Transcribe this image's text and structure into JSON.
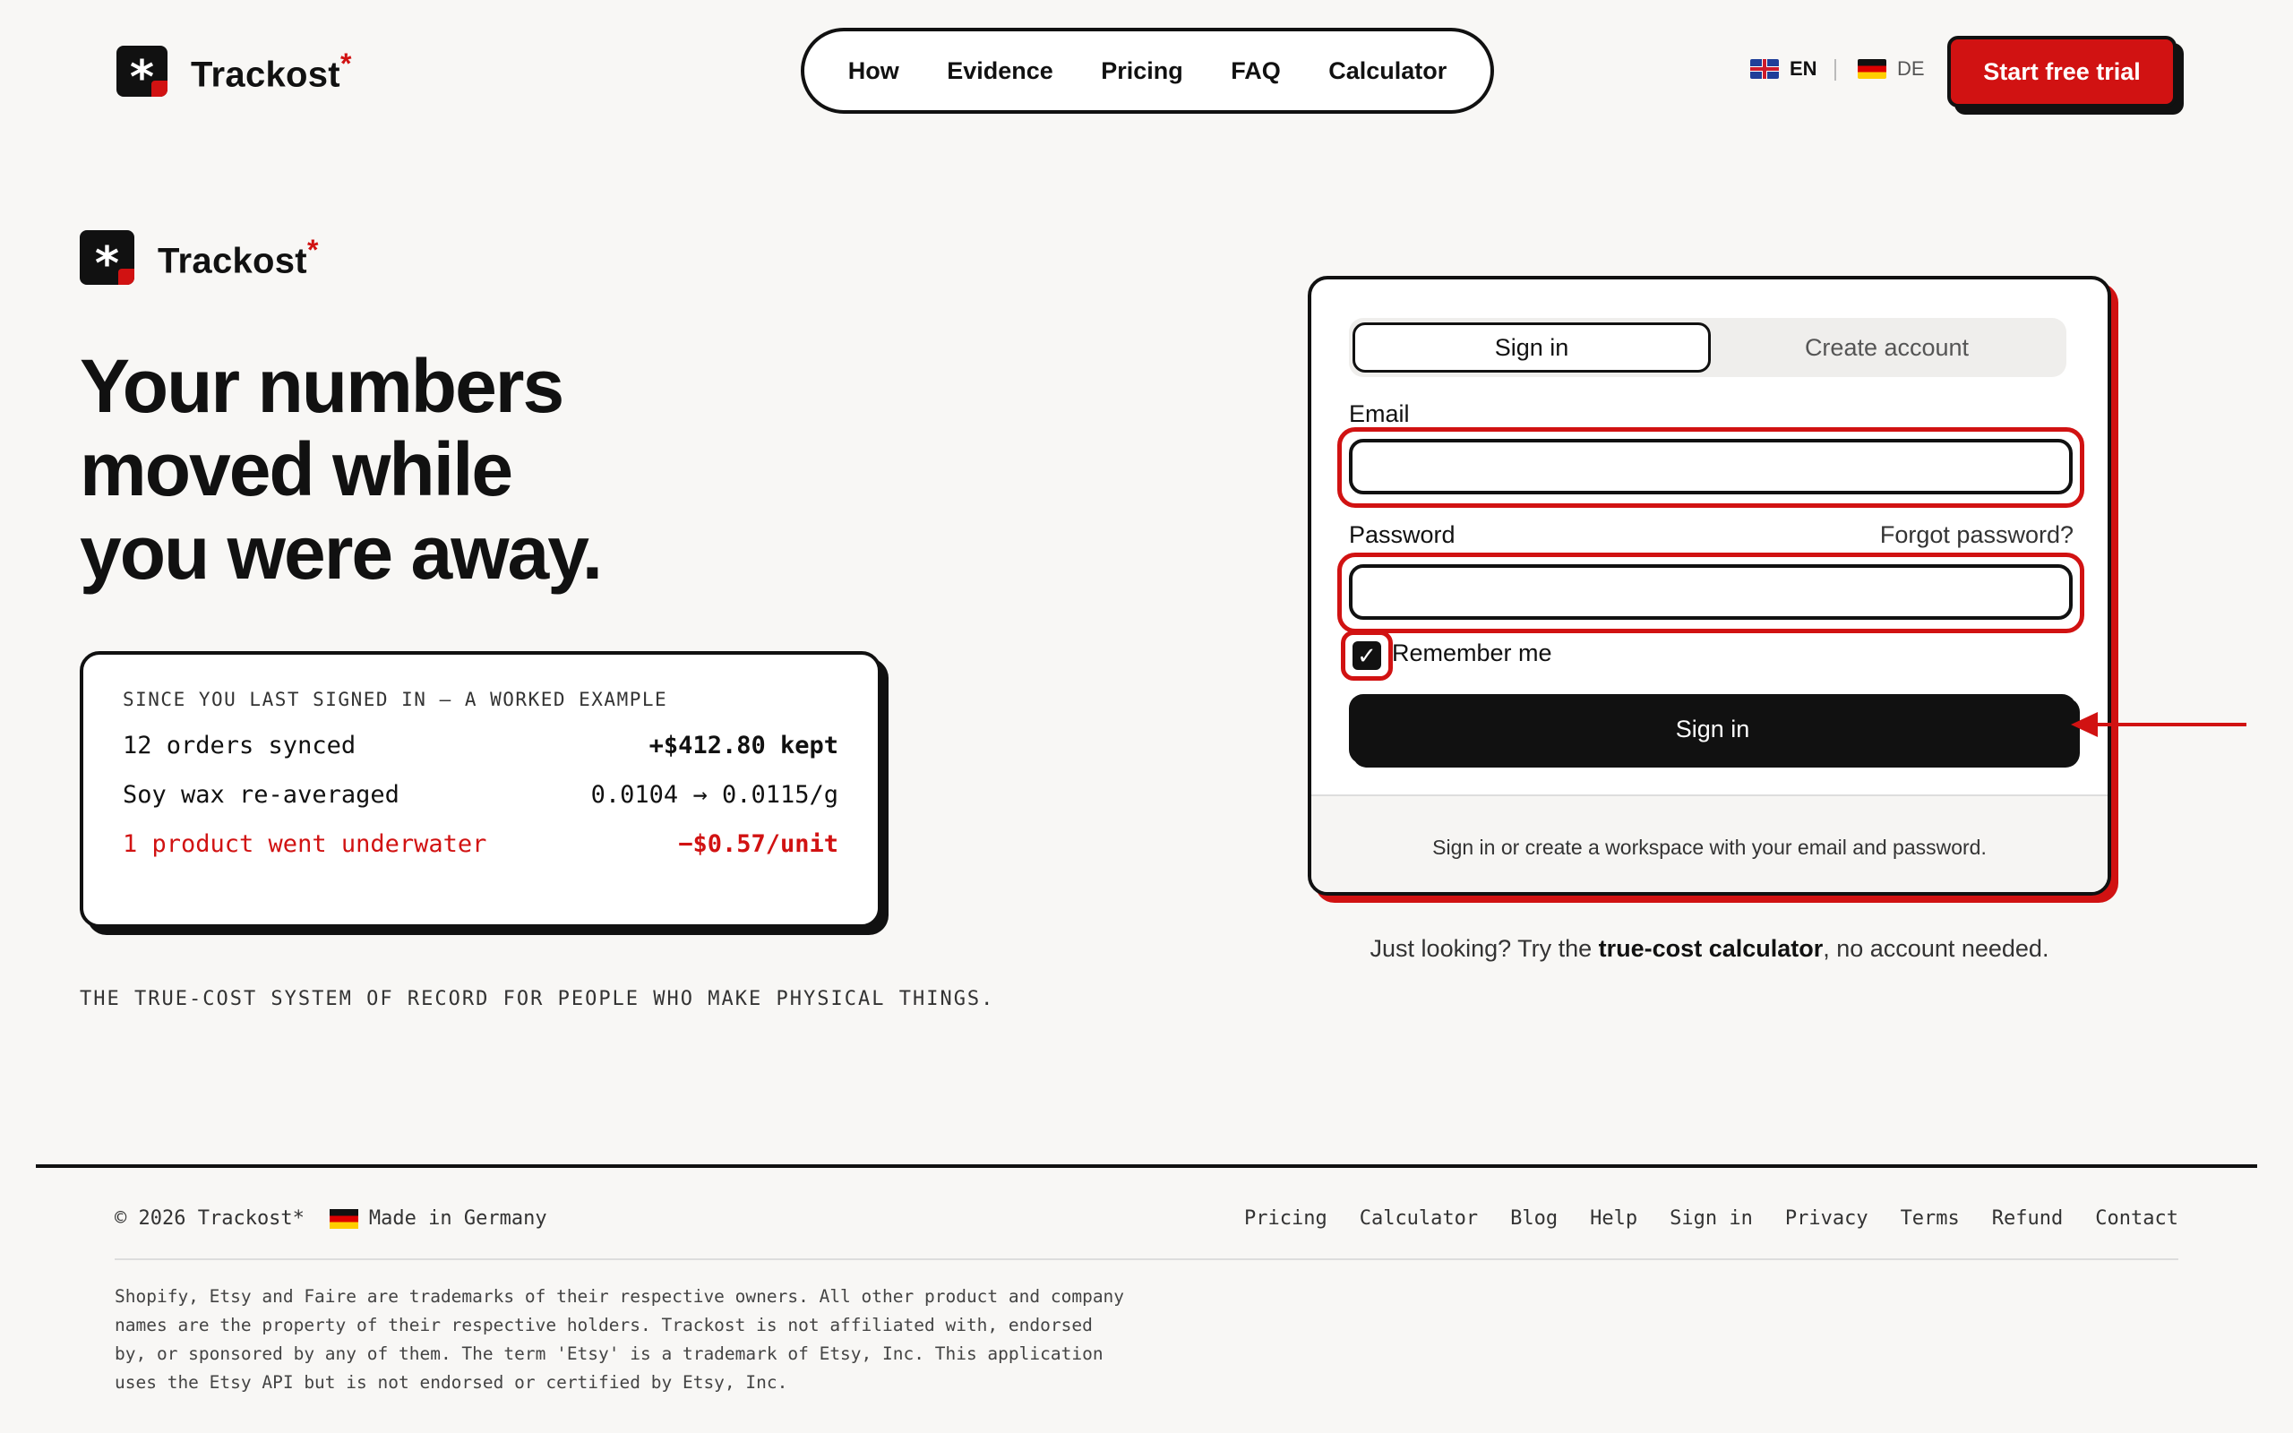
{
  "header": {
    "brand": "Trackost",
    "brand_star": "*",
    "nav": [
      "How",
      "Evidence",
      "Pricing",
      "FAQ",
      "Calculator"
    ],
    "lang_en": "EN",
    "lang_de": "DE",
    "cta": "Start free trial"
  },
  "hero": {
    "brand": "Trackost",
    "brand_star": "*",
    "headline_lines": [
      "Your numbers",
      "moved while",
      "you were away."
    ],
    "example": {
      "caption": "SINCE YOU LAST SIGNED IN — A WORKED EXAMPLE",
      "rows": [
        {
          "label": "12 orders synced",
          "value": "+$412.80 kept"
        },
        {
          "label": "Soy wax re-averaged",
          "value": "0.0104 → 0.0115/g"
        },
        {
          "label": "1 product went underwater",
          "value": "−$0.57/unit"
        }
      ]
    },
    "tagline": "THE TRUE-COST SYSTEM OF RECORD FOR PEOPLE WHO MAKE PHYSICAL THINGS."
  },
  "auth": {
    "tab_signin": "Sign in",
    "tab_create": "Create account",
    "email_label": "Email",
    "email_value": "",
    "password_label": "Password",
    "password_value": "",
    "forgot": "Forgot password?",
    "remember": "Remember me",
    "remember_checked": true,
    "submit": "Sign in",
    "footer_note": "Sign in or create a workspace with your email and password.",
    "just_looking_prefix": "Just looking? Try the ",
    "just_looking_link": "true-cost calculator",
    "just_looking_suffix": ", no account needed."
  },
  "footer": {
    "copyright": "© 2026 Trackost*",
    "made_in": "Made in Germany",
    "links": [
      "Pricing",
      "Calculator",
      "Blog",
      "Help",
      "Sign in",
      "Privacy",
      "Terms",
      "Refund",
      "Contact"
    ],
    "legal_lines": [
      "Shopify, Etsy and Faire are trademarks of their respective owners. All other product and company",
      "names are the property of their respective holders. Trackost is not affiliated with, endorsed",
      "by, or sponsored by any of them. The term 'Etsy' is a trademark of Etsy, Inc. This application",
      "uses the Etsy API but is not endorsed or certified by Etsy, Inc."
    ]
  },
  "colors": {
    "accent": "#d11212",
    "ink": "#111111",
    "background": "#f8f7f5"
  },
  "icons": {
    "logo": "asterisk-logo-icon",
    "check": "checkmark-icon",
    "arrow": "arrow-left-icon",
    "flag_en": "flag-uk-icon",
    "flag_de": "flag-germany-icon"
  }
}
